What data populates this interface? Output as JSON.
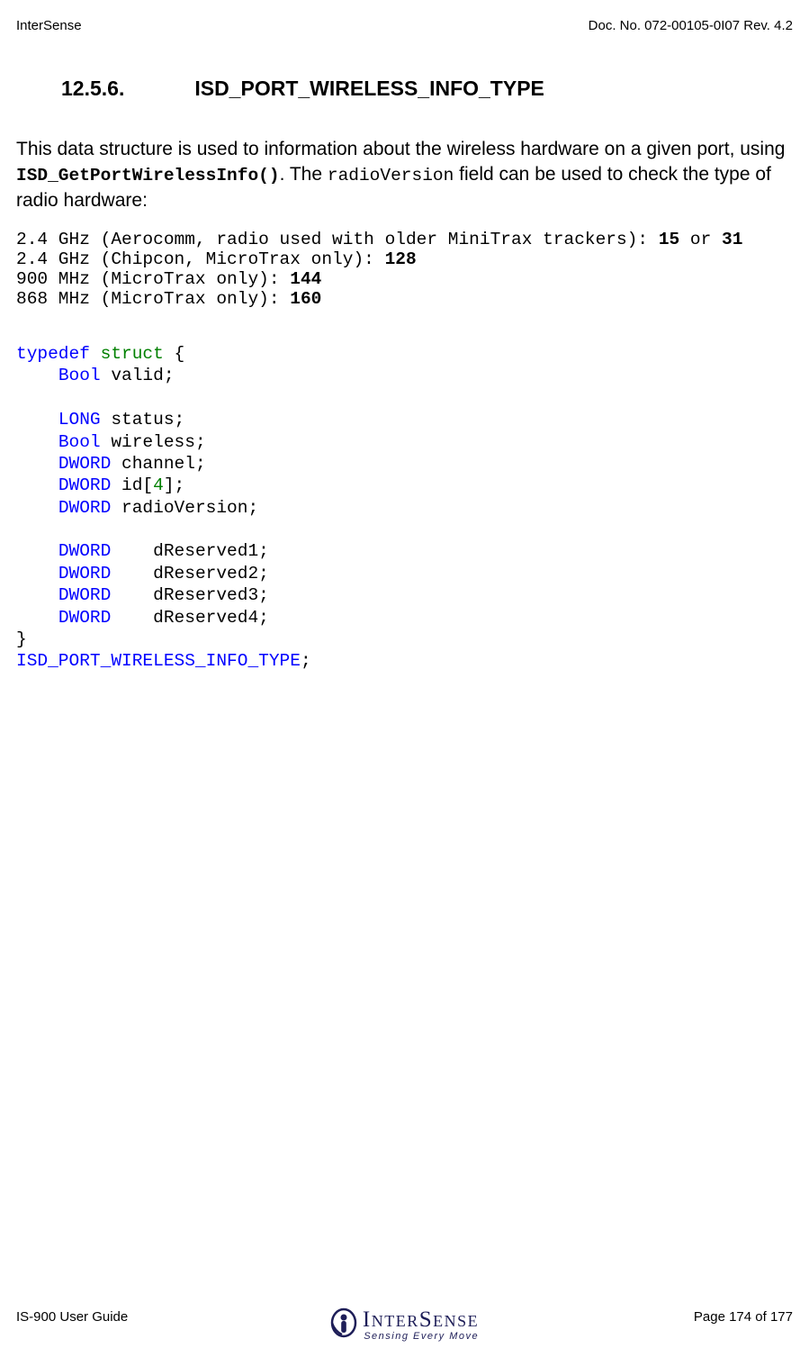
{
  "header": {
    "left": "InterSense",
    "right": "Doc. No. 072-00105-0I07 Rev. 4.2"
  },
  "section": {
    "number": "12.5.6.",
    "title": "ISD_PORT_WIRELESS_INFO_TYPE"
  },
  "para": {
    "t1": "This data structure is used to information about the wireless hardware on a given port, using ",
    "fn": "ISD_GetPortWirelessInfo()",
    "t2": ".   The ",
    "field": "radioVersion",
    "t3": " field can be used to check the type of radio hardware:"
  },
  "radio": {
    "l1a": "2.4 GHz (Aerocomm, radio used with older MiniTrax trackers): ",
    "l1b": "15",
    "l1c": " or ",
    "l1d": "31",
    "l2a": "2.4 GHz (Chipcon, MicroTrax only): ",
    "l2b": "128",
    "l3a": "900 MHz (MicroTrax only): ",
    "l3b": "144",
    "l4a": "868 MHz (MicroTrax only): ",
    "l4b": "160"
  },
  "code": {
    "typedef": "typedef",
    "struct": "struct",
    "brace_open": " {",
    "indent": "    ",
    "t_bool": "Bool",
    "t_long": "LONG",
    "t_dword": "DWORD",
    "f_valid": " valid;",
    "f_status": " status;",
    "f_wireless": " wireless;",
    "f_channel": " channel;",
    "f_id_a": " id[",
    "f_id_num": "4",
    "f_id_b": "];",
    "f_radiov": " radioVersion;",
    "res_pad": "    ",
    "f_r1": "dReserved1;",
    "f_r2": "dReserved2;",
    "f_r3": "dReserved3;",
    "f_r4": "dReserved4;",
    "brace_close": "}",
    "typename": "ISD_PORT_WIRELESS_INFO_TYPE",
    "semi": ";"
  },
  "footer": {
    "left": "IS-900 User Guide",
    "right": "Page 174 of 177"
  },
  "logo": {
    "main": "InterSense",
    "sub": "Sensing Every Move"
  }
}
